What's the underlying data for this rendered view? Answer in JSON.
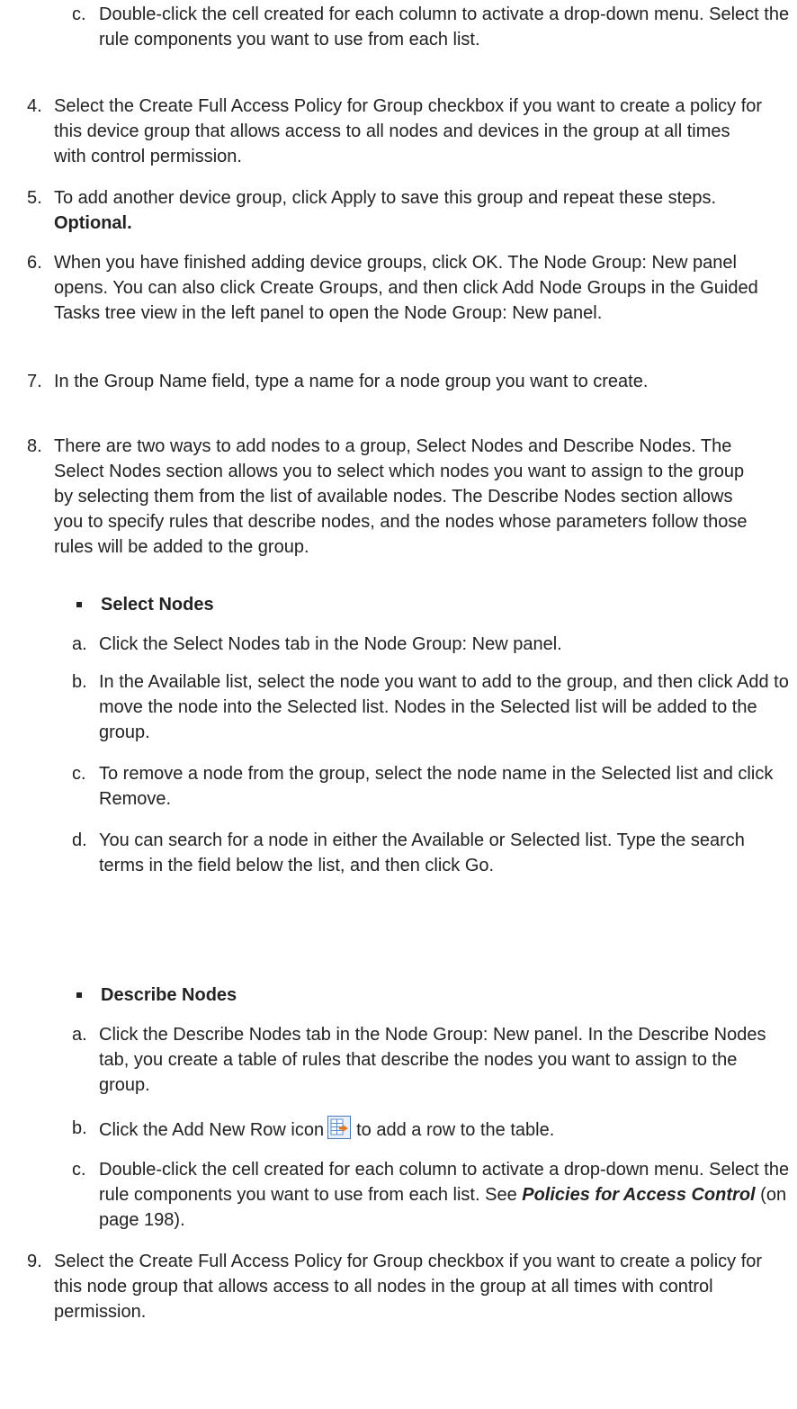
{
  "items": {
    "c_top": {
      "marker": "c.",
      "text": "Double-click the cell created for each column to activate a drop-down menu. Select the rule components you want to use from each list."
    },
    "s4": {
      "marker": "4.",
      "text": "Select the Create Full Access Policy for Group checkbox if you want to create a policy for this device group that allows access to all nodes and devices in the group at all times with control permission."
    },
    "s5": {
      "marker": "5.",
      "text": "To add another device group, click Apply to save this group and repeat these steps.",
      "bold": "Optional."
    },
    "s6": {
      "marker": "6.",
      "text": "When you have finished adding device groups, click OK. The Node Group: New panel opens. You can also click Create Groups, and then click Add Node Groups in the Guided Tasks tree view in the left panel to open the Node Group: New panel."
    },
    "s7": {
      "marker": "7.",
      "text": "In the Group Name field, type a name for a node group you want to create."
    },
    "s8": {
      "marker": "8.",
      "text": "There are two ways to add nodes to a group, Select Nodes and Describe Nodes. The Select Nodes section allows you to select which nodes you want to assign to the group by selecting them from the list of available nodes. The Describe Nodes section allows you to specify rules that describe nodes, and the nodes whose parameters follow those rules will be added to the group."
    },
    "bullet_select": {
      "text": "Select Nodes"
    },
    "sel_a": {
      "marker": "a.",
      "text": "Click the Select Nodes tab in the Node Group: New panel."
    },
    "sel_b": {
      "marker": "b.",
      "text": "In the Available list, select the node you want to add to the group, and then click Add to move the node into the Selected list. Nodes in the Selected list will be added to the group."
    },
    "sel_c": {
      "marker": "c.",
      "text": "To remove a node from the group, select the node name in the Selected list and click Remove."
    },
    "sel_d": {
      "marker": "d.",
      "text": "You can search for a node in either the Available or Selected list. Type the search terms in the field below the list, and then click Go."
    },
    "bullet_describe": {
      "text": "Describe Nodes"
    },
    "des_a": {
      "marker": "a.",
      "text": "Click the Describe Nodes tab in the Node Group: New panel. In the Describe Nodes tab, you create a table of rules that describe the nodes you want to assign to the group."
    },
    "des_b": {
      "marker": "b.",
      "text_before": "Click the Add New Row icon",
      "text_after": "to add a row to the table.",
      "icon": "add-new-row-icon"
    },
    "des_c": {
      "marker": "c.",
      "text": "Double-click the cell created for each column to activate a drop-down menu. Select the rule components you want to use from each list. See",
      "link": "Policies for Access Control",
      "suffix": "(on page 198)."
    },
    "s9": {
      "marker": "9.",
      "text": "Select the Create Full Access Policy for Group checkbox if you want to create a policy for this node group that allows access to all nodes in the group at all times with control permission."
    }
  },
  "colors": {
    "text": "#222222",
    "icon_border": "#4a78b5",
    "icon_grid": "#5b8fd0",
    "icon_arrow": "#e8761e"
  }
}
